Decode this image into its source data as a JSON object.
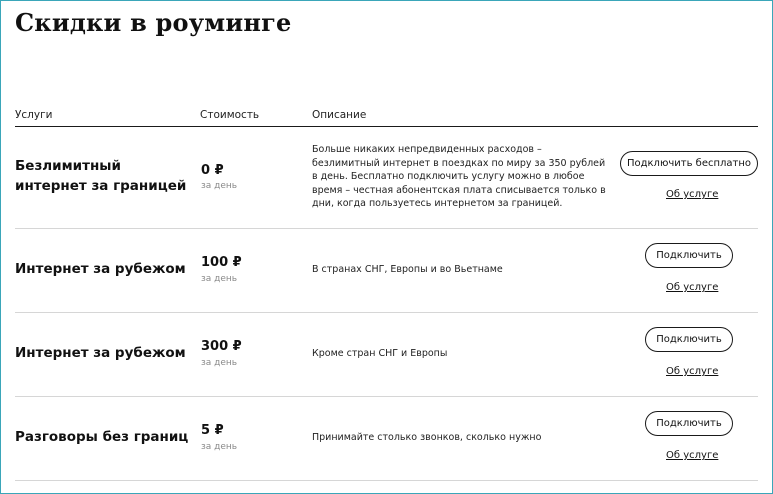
{
  "page": {
    "title": "Скидки в роуминге"
  },
  "table": {
    "headers": {
      "service": "Услуги",
      "cost": "Стоимость",
      "description": "Описание"
    },
    "rows": [
      {
        "name_line1": "Безлимитный",
        "name_line2": "интернет за границей",
        "price": "0 ₽",
        "period": "за день",
        "description": "Больше никаких непредвиденных расходов – безлимитный интернет в поездках по миру за 350 рублей в день. Бесплатно подключить услугу можно в любое время – честная абонентская плата списывается только в дни, когда пользуетесь интернетом за границей.",
        "button": "Подключить бесплатно",
        "link": "Об услуге"
      },
      {
        "name_line1": "Интернет за рубежом",
        "price": "100 ₽",
        "period": "за день",
        "description": "В странах СНГ, Европы и во Вьетнаме",
        "button": "Подключить",
        "link": "Об услуге"
      },
      {
        "name_line1": "Интернет за рубежом",
        "price": "300 ₽",
        "period": "за день",
        "description": "Кроме стран СНГ и Европы",
        "button": "Подключить",
        "link": "Об услуге"
      },
      {
        "name_line1": "Разговоры без границ",
        "price": "5 ₽",
        "period": "за день",
        "description": "Принимайте столько звонков, сколько нужно",
        "button": "Подключить",
        "link": "Об услуге"
      }
    ]
  },
  "colors": {
    "frame_border": "#3aa6b9",
    "text": "#1a1a1a",
    "muted": "#8a8a8a"
  }
}
